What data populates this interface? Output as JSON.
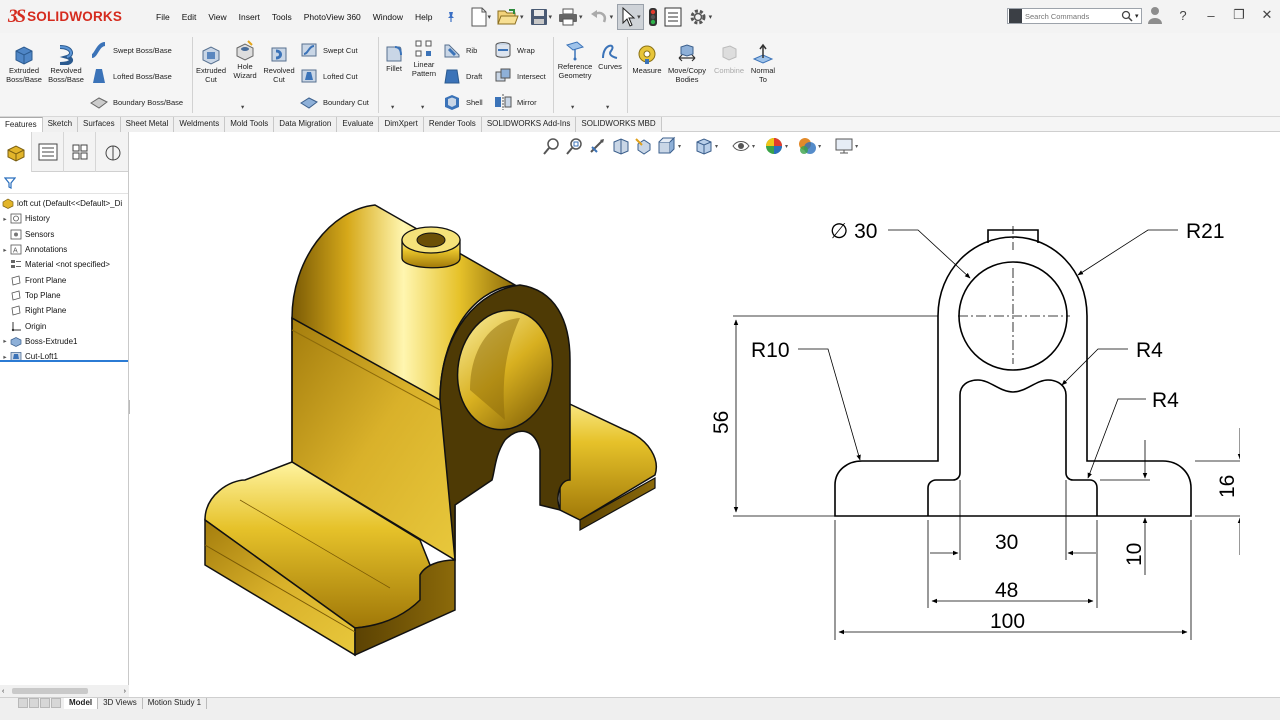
{
  "app": {
    "logo_mark": "3S",
    "logo_text": "SOLIDWORKS"
  },
  "menu": [
    "File",
    "Edit",
    "View",
    "Insert",
    "Tools",
    "PhotoView 360",
    "Window",
    "Help"
  ],
  "search": {
    "placeholder": "Search Commands"
  },
  "ribbon": {
    "extruded_boss": "Extruded Boss/Base",
    "revolved_boss": "Revolved Boss/Base",
    "swept_boss": "Swept Boss/Base",
    "lofted_boss": "Lofted Boss/Base",
    "boundary_boss": "Boundary Boss/Base",
    "extruded_cut": "Extruded Cut",
    "hole_wizard": "Hole Wizard",
    "revolved_cut": "Revolved Cut",
    "swept_cut": "Swept Cut",
    "lofted_cut": "Lofted Cut",
    "boundary_cut": "Boundary Cut",
    "fillet": "Fillet",
    "linear_pattern": "Linear Pattern",
    "rib": "Rib",
    "draft": "Draft",
    "shell": "Shell",
    "wrap": "Wrap",
    "intersect": "Intersect",
    "mirror": "Mirror",
    "reference_geometry": "Reference Geometry",
    "curves": "Curves",
    "measure": "Measure",
    "move_copy": "Move/Copy Bodies",
    "combine": "Combine",
    "normal_to": "Normal To"
  },
  "tabs": [
    "Features",
    "Sketch",
    "Surfaces",
    "Sheet Metal",
    "Weldments",
    "Mold Tools",
    "Data Migration",
    "Evaluate",
    "DimXpert",
    "Render Tools",
    "SOLIDWORKS Add-Ins",
    "SOLIDWORKS MBD"
  ],
  "tree": {
    "root": "loft cut  (Default<<Default>_Di",
    "items": [
      "History",
      "Sensors",
      "Annotations",
      "Material <not specified>",
      "Front Plane",
      "Top Plane",
      "Right Plane",
      "Origin",
      "Boss-Extrude1",
      "Cut-Loft1"
    ]
  },
  "bottom_tabs": [
    "Model",
    "3D Views",
    "Motion Study 1"
  ],
  "drawing": {
    "dims": {
      "diameter": "∅ 30",
      "r21": "R21",
      "r10": "R10",
      "r4_top": "R4",
      "r4_bottom": "R4",
      "height_56": "56",
      "width_30": "30",
      "width_48": "48",
      "width_100": "100",
      "height_10": "10",
      "height_16": "16"
    }
  },
  "colors": {
    "accent": "#2b7bd4",
    "brand": "#d52b1e",
    "part_gold": "#d8b020"
  }
}
